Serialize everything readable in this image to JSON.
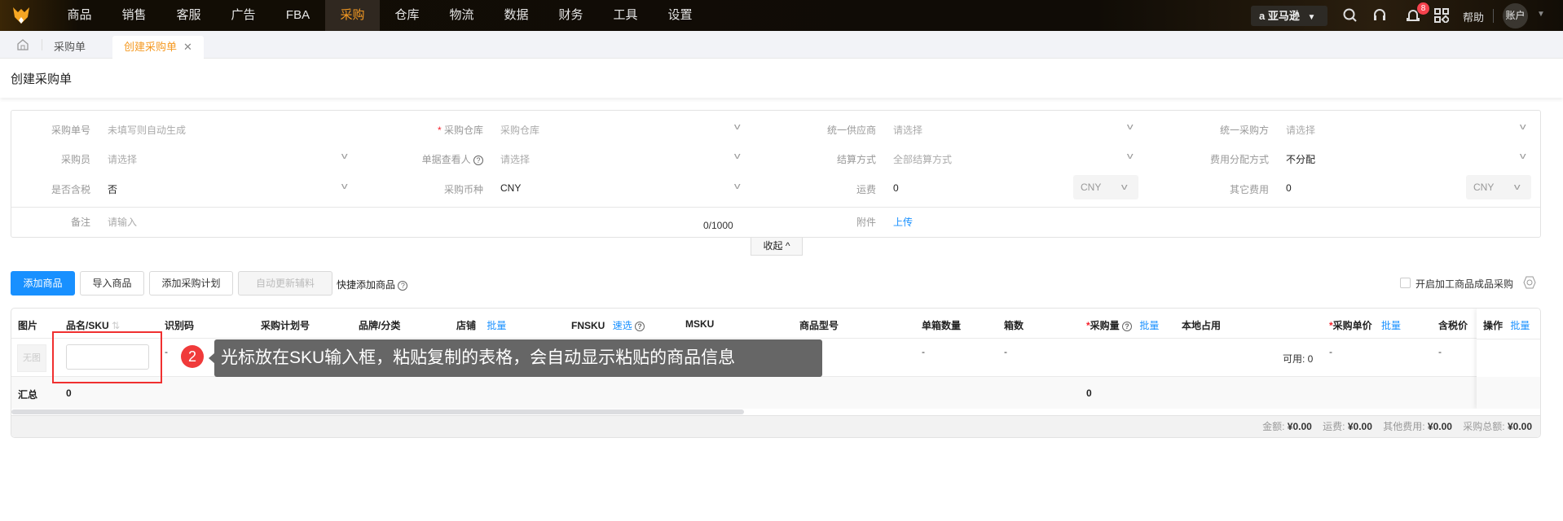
{
  "nav": {
    "items": [
      "商品",
      "销售",
      "客服",
      "广告",
      "FBA",
      "采购",
      "仓库",
      "物流",
      "数据",
      "财务",
      "工具",
      "设置"
    ],
    "active_index": 5,
    "marketplace": "亚马逊",
    "notification_count": "8",
    "help": "帮助",
    "account": "账户"
  },
  "tabs": {
    "items": [
      "采购单",
      "创建采购单"
    ]
  },
  "page": {
    "title": "创建采购单"
  },
  "form": {
    "order_no": {
      "label": "采购单号",
      "placeholder": "未填写则自动生成"
    },
    "warehouse": {
      "label": "采购仓库",
      "placeholder": "采购仓库"
    },
    "supplier": {
      "label": "统一供应商",
      "placeholder": "请选择"
    },
    "purchaser_party": {
      "label": "统一采购方",
      "placeholder": "请选择"
    },
    "buyer": {
      "label": "采购员",
      "placeholder": "请选择"
    },
    "viewer": {
      "label": "单据查看人",
      "placeholder": "请选择"
    },
    "settlement": {
      "label": "结算方式",
      "placeholder": "全部结算方式"
    },
    "cost_alloc": {
      "label": "费用分配方式",
      "value": "不分配"
    },
    "tax": {
      "label": "是否含税",
      "value": "否"
    },
    "currency": {
      "label": "采购币种",
      "value": "CNY"
    },
    "freight": {
      "label": "运费",
      "value": "0",
      "currency": "CNY"
    },
    "other_fee": {
      "label": "其它费用",
      "value": "0",
      "currency": "CNY"
    },
    "note": {
      "label": "备注",
      "placeholder": "请输入",
      "counter": "0/1000"
    },
    "attachment": {
      "label": "附件",
      "upload": "上传"
    },
    "collapse": "收起"
  },
  "toolbar": {
    "add_product": "添加商品",
    "import_product": "导入商品",
    "add_plan": "添加采购计划",
    "auto_update": "自动更新辅料",
    "quick_add": "快捷添加商品",
    "processing_toggle": "开启加工商品成品采购"
  },
  "table": {
    "headers": {
      "image": "图片",
      "name_sku": "品名/SKU",
      "id_code": "识别码",
      "plan_no": "采购计划号",
      "brand": "品牌/分类",
      "shop": "店铺",
      "fnsku": "FNSKU",
      "msku": "MSKU",
      "model": "商品型号",
      "per_box": "单箱数量",
      "boxes": "箱数",
      "qty": "采购量",
      "local": "本地占用",
      "unit_price": "采购单价",
      "tax_price": "含税价",
      "action": "操作"
    },
    "batch": "批量",
    "quick_select": "速选",
    "required_mark": "*",
    "row": {
      "no_image": "无图",
      "id_code": "-",
      "per_box": "-",
      "boxes": "-",
      "available": "可用: 0",
      "unit_price": "-",
      "tax_price": "-"
    },
    "summary": {
      "label": "汇总",
      "count": "0",
      "qty": "0"
    },
    "footer": {
      "amount_label": "金额:",
      "amount": "¥0.00",
      "freight_label": "运费:",
      "freight": "¥0.00",
      "other_label": "其他费用:",
      "other": "¥0.00",
      "total_label": "采购总额:",
      "total": "¥0.00"
    }
  },
  "annotation": {
    "step": "2",
    "text": "光标放在SKU输入框，粘贴复制的表格，会自动显示粘贴的商品信息"
  }
}
